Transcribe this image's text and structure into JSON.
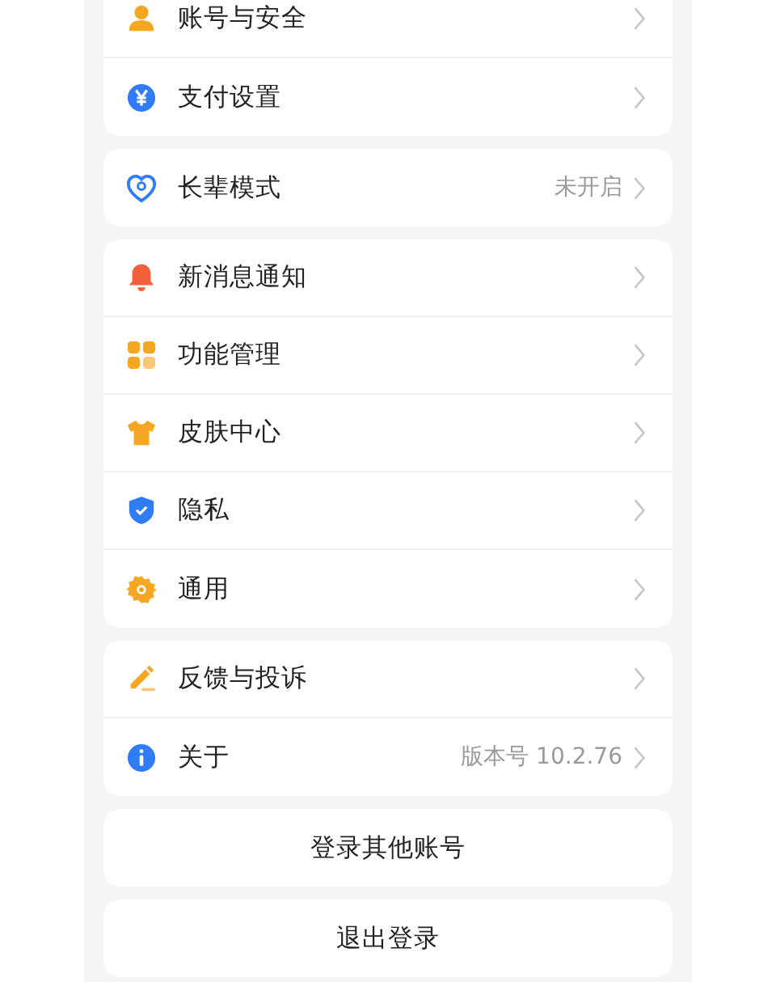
{
  "groups": [
    {
      "items": [
        {
          "kind": "person",
          "label": "账号与安全"
        },
        {
          "kind": "yen",
          "label": "支付设置"
        }
      ]
    },
    {
      "items": [
        {
          "kind": "heart",
          "label": "长辈模式",
          "value": "未开启"
        }
      ]
    },
    {
      "items": [
        {
          "kind": "bell",
          "label": "新消息通知"
        },
        {
          "kind": "grid",
          "label": "功能管理"
        },
        {
          "kind": "shirt",
          "label": "皮肤中心"
        },
        {
          "kind": "shield",
          "label": "隐私"
        },
        {
          "kind": "gear",
          "label": "通用"
        }
      ]
    },
    {
      "items": [
        {
          "kind": "pencil",
          "label": "反馈与投诉"
        },
        {
          "kind": "info",
          "label": "关于",
          "value": "版本号 10.2.76"
        }
      ]
    }
  ],
  "buttons": [
    {
      "label": "登录其他账号"
    },
    {
      "label": "退出登录"
    }
  ]
}
